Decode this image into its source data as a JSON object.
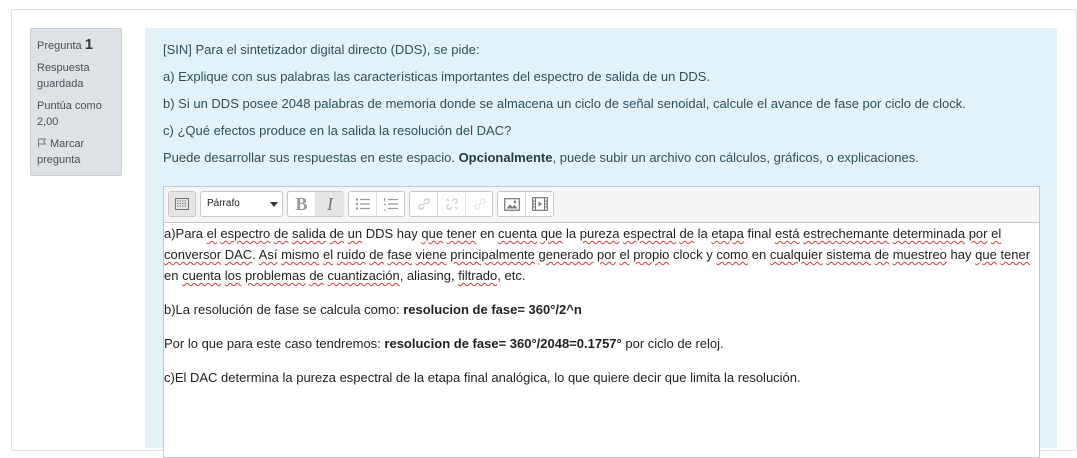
{
  "info": {
    "question_label": "Pregunta",
    "question_number": "1",
    "state_line1": "Respuesta",
    "state_line2": "guardada",
    "grade_line1": "Puntúa como",
    "grade_line2": "2,00",
    "flag_line1": "Marcar",
    "flag_line2": "pregunta"
  },
  "question": {
    "line1": "[SIN] Para el sintetizador digital directo (DDS), se pide:",
    "line2": "a) Explique con sus palabras las características importantes del espectro de salida de un DDS.",
    "line3": "b) Si un DDS posee 2048 palabras de memoria donde se almacena un ciclo de señal senoidal, calcule el avance de fase por ciclo de clock.",
    "line4": "c) ¿Qué efectos produce en la salida la resolución del DAC?",
    "line5_pre": "Puede desarrollar sus respuestas en este espacio. ",
    "line5_bold": "Opcionalmente",
    "line5_post": ", puede subir un archivo con cálculos, gráficos, o explicaciones."
  },
  "editor": {
    "format_select": "Párrafo",
    "toolbar_icons": [
      "show-more-icon",
      "bold-icon",
      "italic-icon",
      "bullet-list-icon",
      "numbered-list-icon",
      "link-icon",
      "unlink-icon",
      "anchor-icon",
      "image-icon",
      "media-icon"
    ],
    "bold_label": "B",
    "italic_label": "I"
  },
  "answer": {
    "p1_words": [
      [
        "a)Para ",
        false
      ],
      [
        "el",
        true
      ],
      [
        " ",
        false
      ],
      [
        "espectro",
        true
      ],
      [
        " ",
        false
      ],
      [
        "de",
        true
      ],
      [
        " ",
        false
      ],
      [
        "salida",
        true
      ],
      [
        " ",
        false
      ],
      [
        "de",
        true
      ],
      [
        " ",
        false
      ],
      [
        "un",
        true
      ],
      [
        " DDS hay ",
        false
      ],
      [
        "que",
        true
      ],
      [
        " ",
        false
      ],
      [
        "tener",
        true
      ],
      [
        " en ",
        false
      ],
      [
        "cuenta",
        true
      ],
      [
        " ",
        false
      ],
      [
        "que",
        true
      ],
      [
        " la ",
        false
      ],
      [
        "pureza",
        true
      ],
      [
        " ",
        false
      ],
      [
        "espectral",
        true
      ],
      [
        " ",
        false
      ],
      [
        "de",
        true
      ],
      [
        " la ",
        false
      ],
      [
        "etapa",
        true
      ],
      [
        " final ",
        false
      ],
      [
        "está",
        true
      ],
      [
        " ",
        false
      ],
      [
        "estrechemante",
        true
      ],
      [
        " ",
        false
      ],
      [
        "determinada",
        true
      ],
      [
        " ",
        false
      ],
      [
        "por",
        true
      ],
      [
        " ",
        false
      ],
      [
        "el",
        true
      ],
      [
        " ",
        false
      ],
      [
        "conversor",
        true
      ],
      [
        " ",
        false
      ],
      [
        "DAC",
        true
      ],
      [
        ". ",
        false
      ],
      [
        "Así",
        true
      ],
      [
        " ",
        false
      ],
      [
        "mismo",
        true
      ],
      [
        " ",
        false
      ],
      [
        "el",
        true
      ],
      [
        " ",
        false
      ],
      [
        "ruido",
        true
      ],
      [
        " ",
        false
      ],
      [
        "de",
        true
      ],
      [
        " ",
        false
      ],
      [
        "fase",
        true
      ],
      [
        " ",
        false
      ],
      [
        "viene",
        true
      ],
      [
        " ",
        false
      ],
      [
        "principalmente",
        true
      ],
      [
        " ",
        false
      ],
      [
        "generado",
        true
      ],
      [
        " ",
        false
      ],
      [
        "por",
        true
      ],
      [
        " ",
        false
      ],
      [
        "el",
        true
      ],
      [
        " ",
        false
      ],
      [
        "propio",
        true
      ],
      [
        " clock y ",
        false
      ],
      [
        "como",
        true
      ],
      [
        " en ",
        false
      ],
      [
        "cualquier",
        true
      ],
      [
        " ",
        false
      ],
      [
        "sistema",
        true
      ],
      [
        " ",
        false
      ],
      [
        "de",
        true
      ],
      [
        " ",
        false
      ],
      [
        "muestreo",
        true
      ],
      [
        " hay ",
        false
      ],
      [
        "que",
        true
      ],
      [
        " ",
        false
      ],
      [
        "tener",
        true
      ],
      [
        " en ",
        false
      ],
      [
        "cuenta",
        true
      ],
      [
        " ",
        false
      ],
      [
        "los",
        true
      ],
      [
        " ",
        false
      ],
      [
        "problemas",
        true
      ],
      [
        " ",
        false
      ],
      [
        "de",
        true
      ],
      [
        " ",
        false
      ],
      [
        "cuantización",
        true
      ],
      [
        ", aliasing, ",
        false
      ],
      [
        "filtrado",
        true
      ],
      [
        ", etc.",
        false
      ]
    ],
    "p2_pre": "b)La resolución de fase se calcula como: ",
    "p2_bold": "resolucion de fase",
    "p2_post": "= 360°/2^n",
    "p3_pre": "Por lo que para este caso tendremos: ",
    "p3_bold": "resolucion de fase",
    "p3_bold2": "= 360°/2048=0.1757°",
    "p3_post": " por ciclo de reloj.",
    "p4": "c)El DAC determina la pureza espectral de la etapa final analógica, lo que quiere decir que limita la resolución."
  }
}
